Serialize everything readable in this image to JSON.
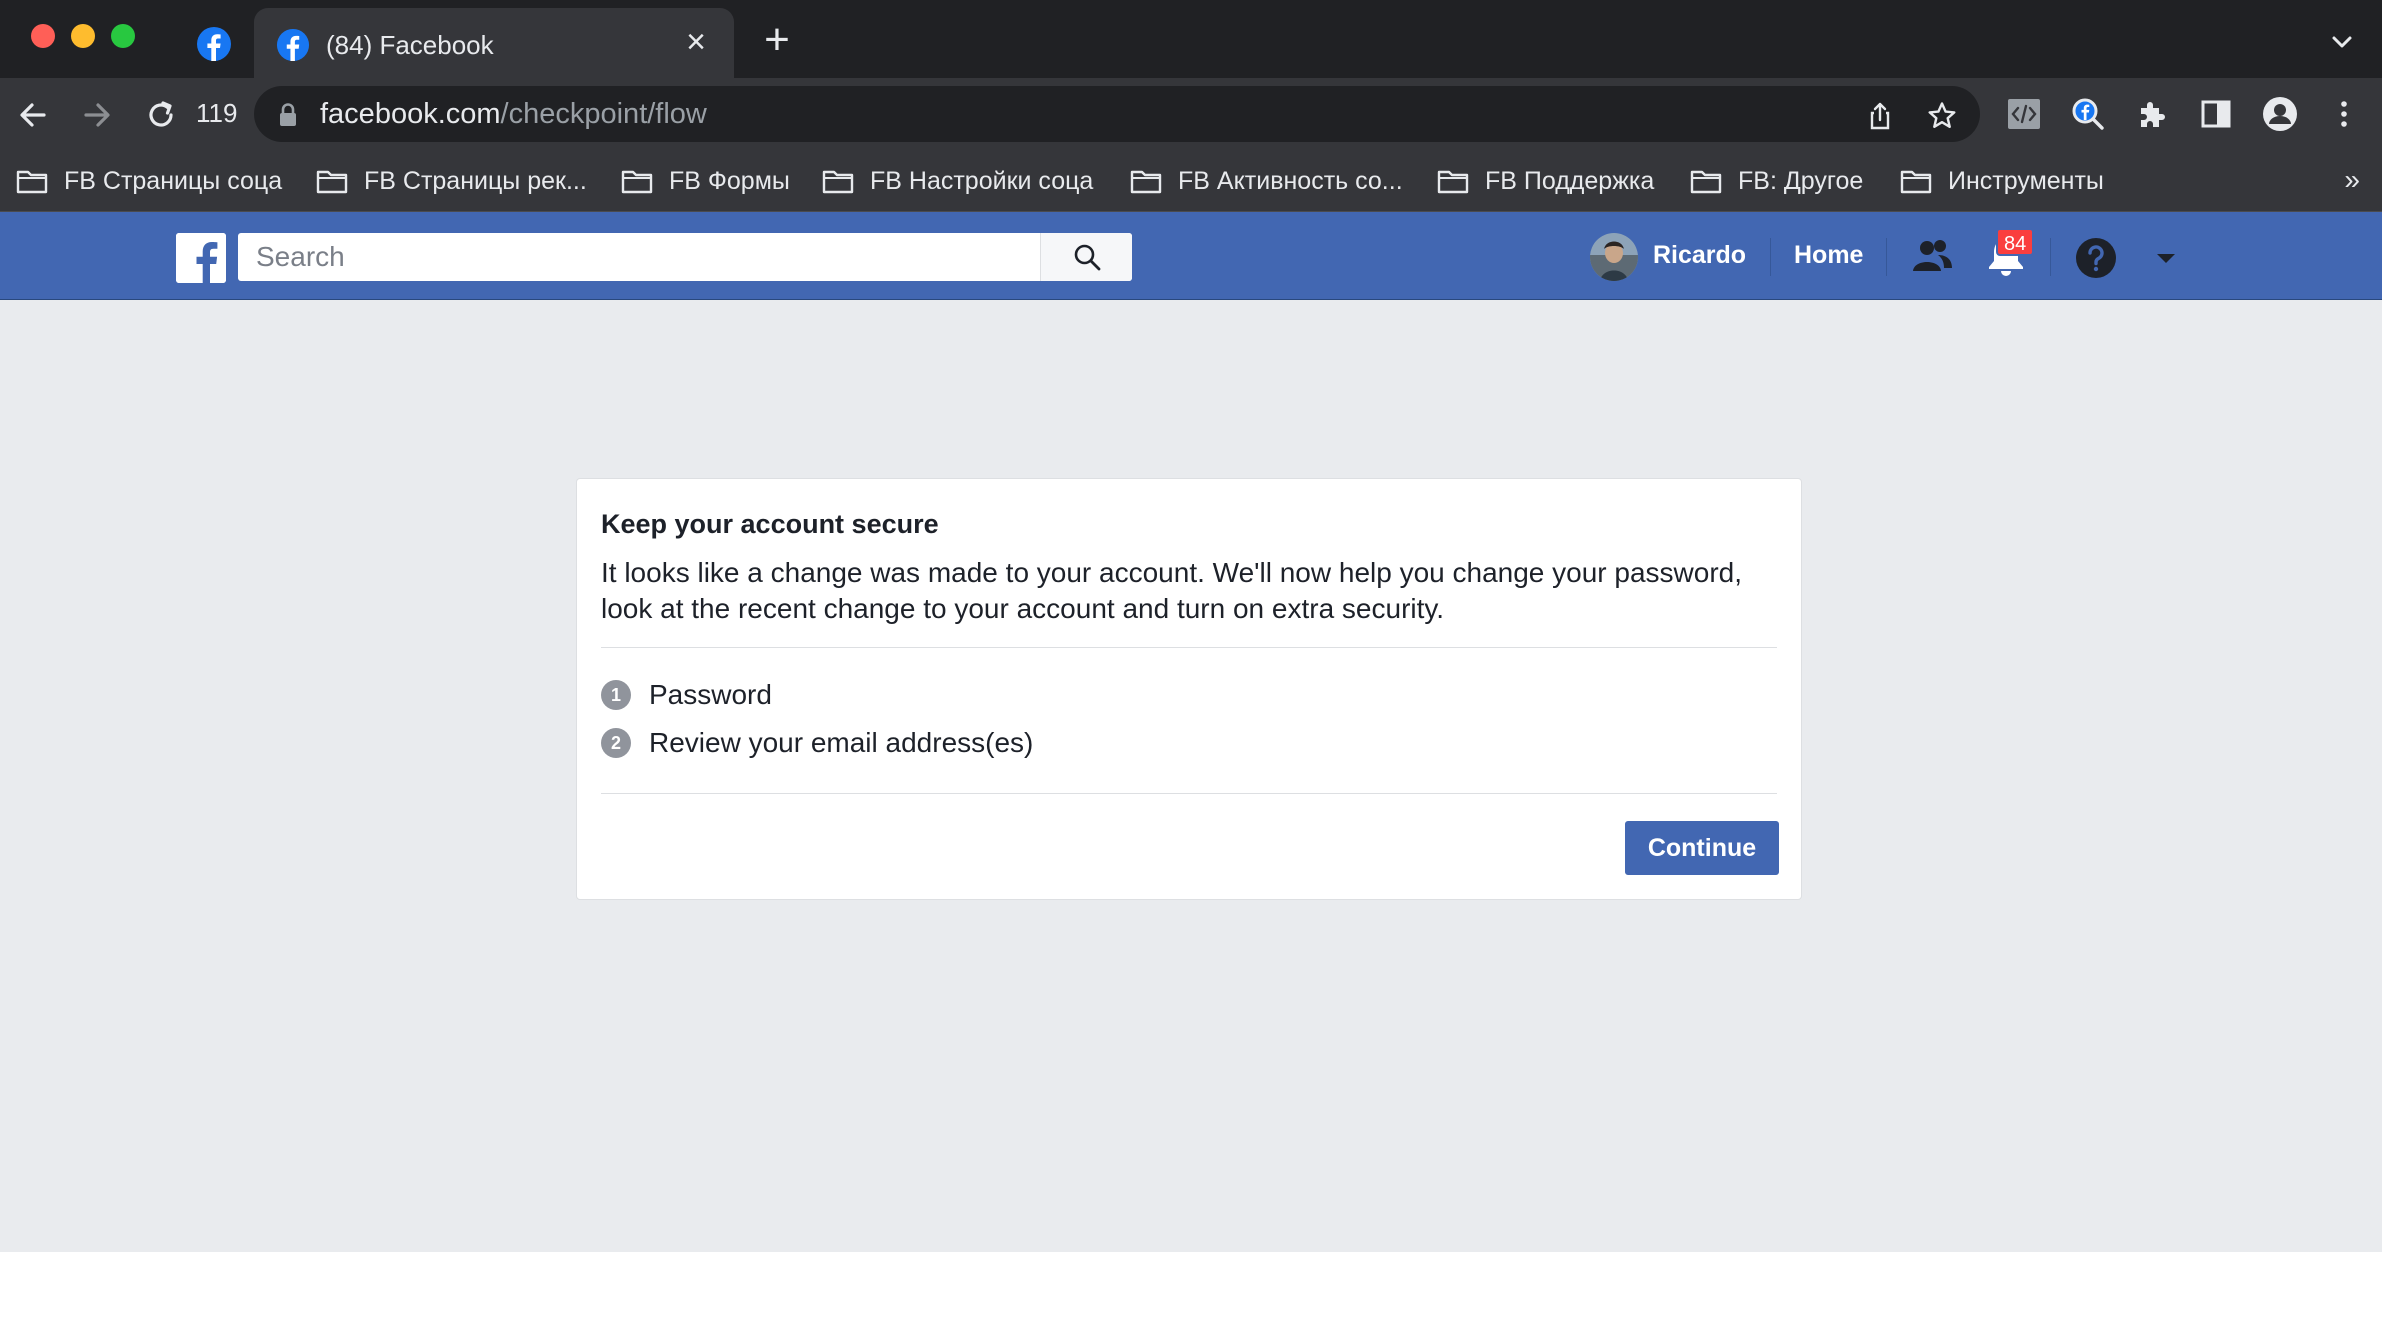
{
  "browser": {
    "active_tab_title": "(84) Facebook",
    "reload_badge": "119",
    "url_host": "facebook.com",
    "url_path": "/checkpoint/flow",
    "bookmarks": [
      {
        "label": "FB Страницы соца"
      },
      {
        "label": "FB Страницы рек..."
      },
      {
        "label": "FB Формы"
      },
      {
        "label": "FB Настройки соца"
      },
      {
        "label": "FB Активность со..."
      },
      {
        "label": "FB Поддержка"
      },
      {
        "label": "FB: Другое"
      },
      {
        "label": "Инструменты"
      }
    ],
    "bookmarks_overflow": "»"
  },
  "fb": {
    "search_placeholder": "Search",
    "user_name": "Ricardo",
    "home_label": "Home",
    "notification_count": "84",
    "brand_color": "#4267b2"
  },
  "checkpoint": {
    "title": "Keep your account secure",
    "description": "It looks like a change was made to your account. We'll now help you change your password, look at the recent change to your account and turn on extra security.",
    "steps": [
      {
        "num": "1",
        "label": "Password"
      },
      {
        "num": "2",
        "label": "Review your email address(es)"
      }
    ],
    "continue_label": "Continue"
  }
}
